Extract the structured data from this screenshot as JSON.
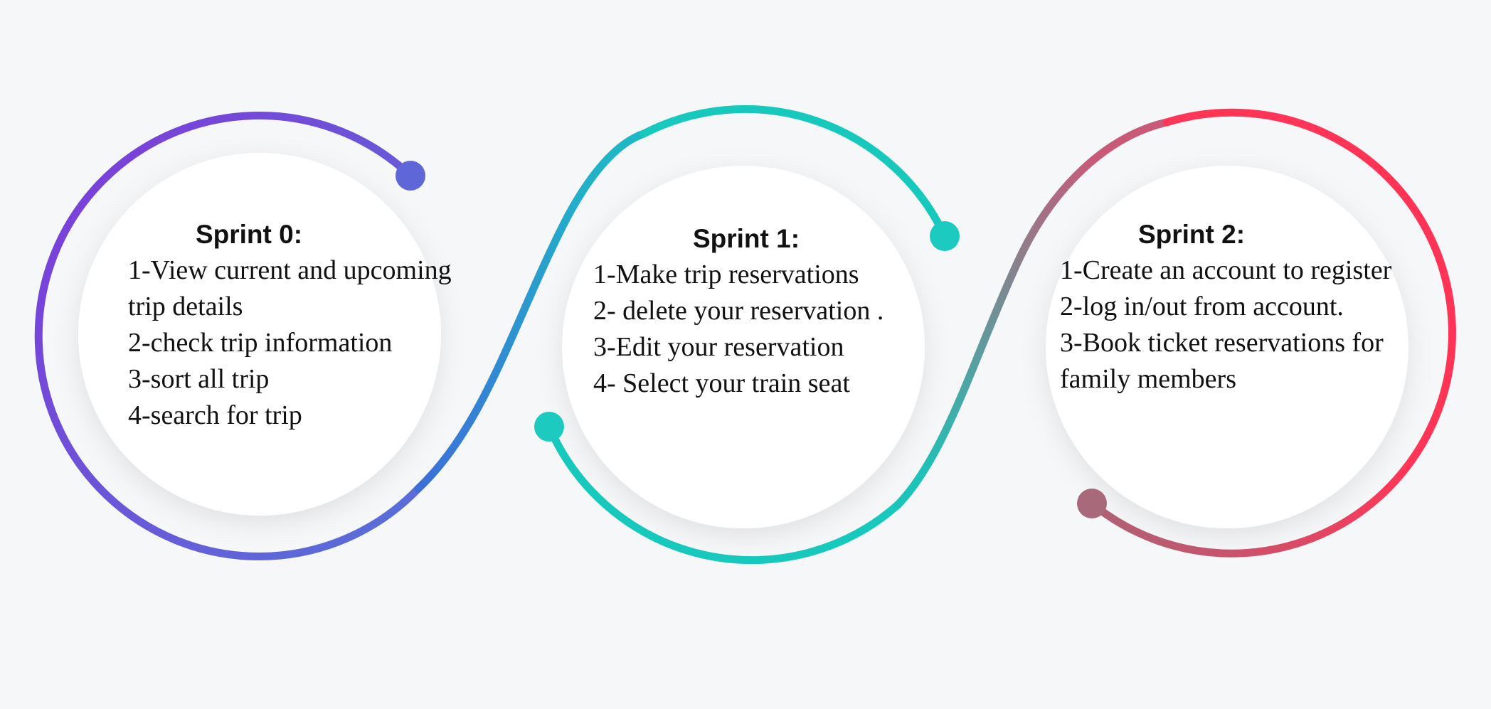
{
  "colors": {
    "background": "#f6f7f9",
    "circle_fill": "#ffffff",
    "sprint0_gradient": [
      "#7b3fd9",
      "#5c6ad6"
    ],
    "sprint1_gradient": [
      "#3b7fd8",
      "#17c8be"
    ],
    "sprint2_gradient": [
      "#1fc2b6",
      "#ff3355"
    ],
    "sprint0_dot": "#5f66d8",
    "sprint1_dot": "#1ccabf",
    "sprint2_dot": "#a8697a"
  },
  "sprints": [
    {
      "title": "Sprint 0:",
      "items": [
        "1-View current and upcoming",
        "trip details",
        "2-check trip information",
        "3-sort all trip",
        "4-search for trip"
      ]
    },
    {
      "title": "Sprint 1:",
      "items": [
        "1-Make trip reservations",
        "2- delete your reservation .",
        "3-Edit your reservation",
        "4- Select your train seat"
      ]
    },
    {
      "title": "Sprint 2:",
      "items": [
        "1-Create an account to register",
        "2-log in/out from account.",
        "3-Book ticket reservations for",
        "family members"
      ]
    }
  ]
}
